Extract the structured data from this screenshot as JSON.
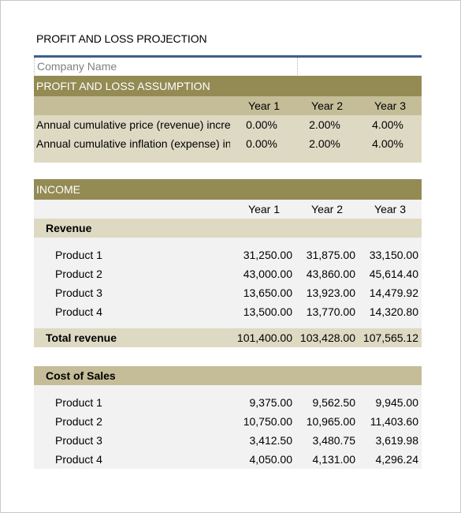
{
  "document": {
    "title": "PROFIT AND LOSS PROJECTION",
    "company_placeholder": "Company Name"
  },
  "assumption": {
    "header": "PROFIT AND LOSS ASSUMPTION",
    "years": [
      "Year 1",
      "Year 2",
      "Year 3"
    ],
    "rows": [
      {
        "label": "Annual cumulative price (revenue) increase",
        "values": [
          "0.00%",
          "2.00%",
          "4.00%"
        ]
      },
      {
        "label": "Annual cumulative inflation (expense) increase",
        "values": [
          "0.00%",
          "2.00%",
          "4.00%"
        ]
      }
    ]
  },
  "income": {
    "header": "INCOME",
    "years": [
      "Year 1",
      "Year 2",
      "Year 3"
    ],
    "revenue": {
      "label": "Revenue",
      "rows": [
        {
          "label": "Product 1",
          "values": [
            "31,250.00",
            "31,875.00",
            "33,150.00"
          ]
        },
        {
          "label": "Product 2",
          "values": [
            "43,000.00",
            "43,860.00",
            "45,614.40"
          ]
        },
        {
          "label": "Product 3",
          "values": [
            "13,650.00",
            "13,923.00",
            "14,479.92"
          ]
        },
        {
          "label": "Product 4",
          "values": [
            "13,500.00",
            "13,770.00",
            "14,320.80"
          ]
        }
      ],
      "total": {
        "label": "Total revenue",
        "values": [
          "101,400.00",
          "103,428.00",
          "107,565.12"
        ]
      }
    },
    "cost_of_sales": {
      "label": "Cost of Sales",
      "rows": [
        {
          "label": "Product 1",
          "values": [
            "9,375.00",
            "9,562.50",
            "9,945.00"
          ]
        },
        {
          "label": "Product 2",
          "values": [
            "10,750.00",
            "10,965.00",
            "11,403.60"
          ]
        },
        {
          "label": "Product 3",
          "values": [
            "3,412.50",
            "3,480.75",
            "3,619.98"
          ]
        },
        {
          "label": "Product 4",
          "values": [
            "4,050.00",
            "4,131.00",
            "4,296.24"
          ]
        }
      ]
    }
  },
  "colors": {
    "header_dark": "#948a54",
    "header_mid": "#c4bd97",
    "header_light": "#ddd9c3",
    "row_grey": "#f2f2f2",
    "rule_blue": "#3d5f8e"
  }
}
